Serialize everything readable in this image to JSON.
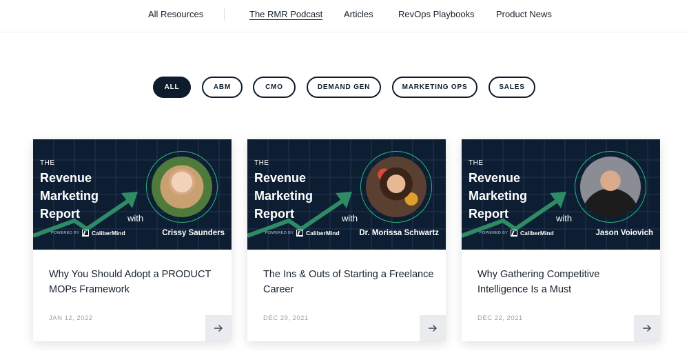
{
  "nav": {
    "items": [
      {
        "label": "All Resources",
        "active": false
      },
      {
        "label": "The RMR Podcast",
        "active": true
      },
      {
        "label": "Articles",
        "active": false
      },
      {
        "label": "RevOps Playbooks",
        "active": false
      },
      {
        "label": "Product News",
        "active": false
      }
    ]
  },
  "filters": [
    {
      "label": "ALL",
      "active": true
    },
    {
      "label": "ABM",
      "active": false
    },
    {
      "label": "CMO",
      "active": false
    },
    {
      "label": "DEMAND GEN",
      "active": false
    },
    {
      "label": "MARKETING OPS",
      "active": false
    },
    {
      "label": "SALES",
      "active": false
    }
  ],
  "banner": {
    "the": "THE",
    "line1": "Revenue",
    "line2": "Marketing",
    "line3": "Report",
    "with": "with",
    "powered_by": "POWERED BY",
    "logo_name": "CaliberMind"
  },
  "cards": [
    {
      "guest": "Crissy Saunders",
      "title": "Why You Should Adopt a PRODUCT MOPs Framework",
      "date": "JAN 12, 2022"
    },
    {
      "guest": "Dr. Morissa Schwartz",
      "title": "The Ins & Outs of Starting a Freelance Career",
      "date": "DEC 29, 2021"
    },
    {
      "guest": "Jason Voiovich",
      "title": "Why Gathering Competitive Intelligence Is a Must",
      "date": "DEC 22, 2021"
    }
  ],
  "icons": {
    "card_link": "arrow-right-icon",
    "brand_logo": "calibermind-logo"
  },
  "colors": {
    "navy": "#0f1c2b",
    "banner": "#0d1e33",
    "accent_green": "#2bb77c",
    "arrow_bg": "#e9ebee"
  }
}
